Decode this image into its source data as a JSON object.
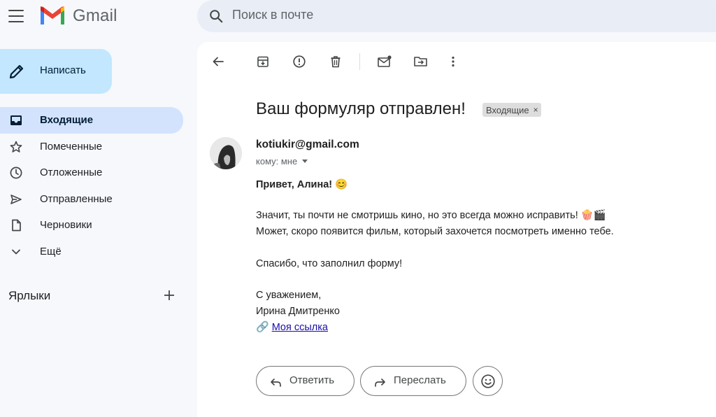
{
  "app": {
    "name": "Gmail"
  },
  "search": {
    "placeholder": "Поиск в почте"
  },
  "compose": {
    "label": "Написать"
  },
  "sidebar": {
    "items": [
      {
        "label": "Входящие",
        "icon": "inbox-icon",
        "active": true
      },
      {
        "label": "Помеченные",
        "icon": "star-icon"
      },
      {
        "label": "Отложенные",
        "icon": "clock-icon"
      },
      {
        "label": "Отправленные",
        "icon": "send-icon"
      },
      {
        "label": "Черновики",
        "icon": "draft-icon"
      },
      {
        "label": "Ещё",
        "icon": "chevron-down-icon"
      }
    ],
    "labels_title": "Ярлыки"
  },
  "toolbar": {
    "icons": [
      "back-arrow-icon",
      "archive-icon",
      "report-spam-icon",
      "delete-icon",
      "mark-unread-icon",
      "move-to-icon",
      "more-vert-icon"
    ]
  },
  "email": {
    "subject": "Ваш формуляр отправлен!",
    "label_chip": "Входящие",
    "label_chip_close": "×",
    "sender": "kotiukir@gmail.com",
    "to": "кому: мне",
    "greeting": "Привет, Алина! 😊",
    "paragraph1_line1": "Значит, ты почти не смотришь кино, но это всегда можно исправить! 🍿🎬",
    "paragraph1_line2": "Может, скоро появится фильм, который захочется посмотреть именно тебе.",
    "paragraph2": "Спасибо, что заполнил форму!",
    "signoff": "С уважением,",
    "signature": "Ирина Дмитренко",
    "link_emoji": "🔗",
    "link_text": "Моя ссылка"
  },
  "actions": {
    "reply": "Ответить",
    "forward": "Переслать"
  },
  "colors": {
    "compose_bg": "#c2e7ff",
    "active_nav_bg": "#d3e3fd",
    "search_bg": "#e9eef6",
    "page_bg": "#f6f8fc",
    "link": "#1a0dab"
  }
}
